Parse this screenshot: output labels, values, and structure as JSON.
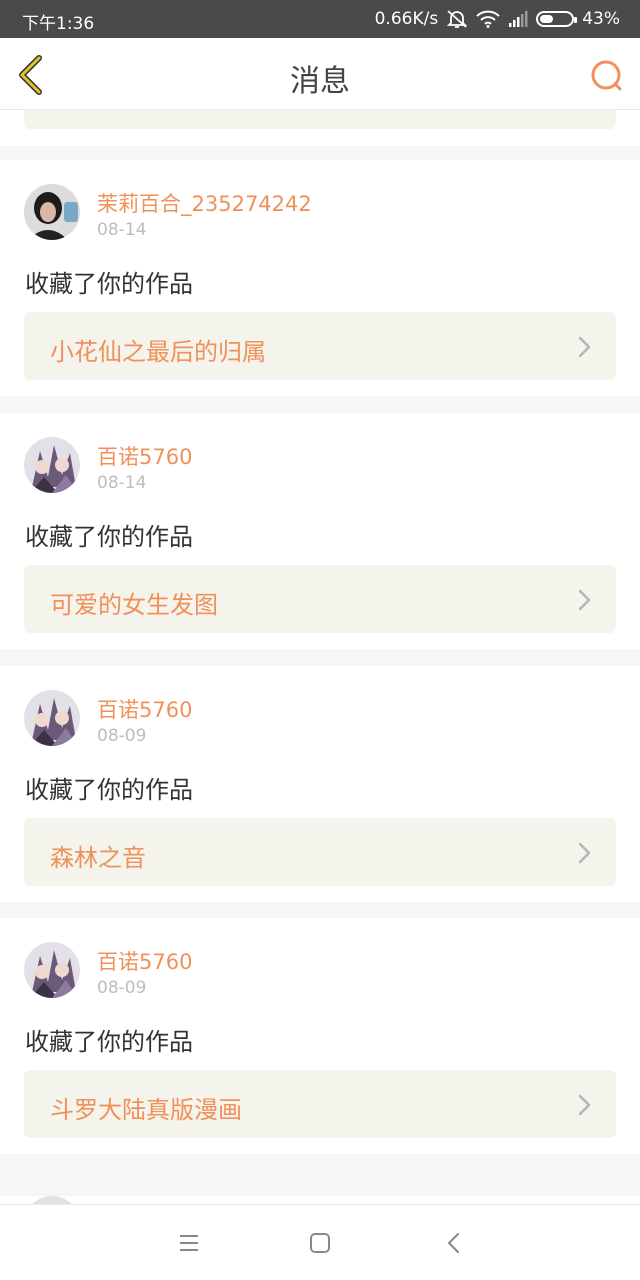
{
  "status_bar": {
    "time": "下午1:36",
    "speed": "0.66K/s",
    "battery": "43%",
    "battery_level": 0.43,
    "icons": [
      "mute-icon",
      "wifi-icon",
      "signal-icon",
      "battery-icon"
    ]
  },
  "header": {
    "title": "消息",
    "back_icon": "back-chevron-icon",
    "search_icon": "search-icon"
  },
  "colors": {
    "accent": "#f0915a",
    "back_icon": "#e6c22a",
    "card_bg": "#f4f3ec",
    "divider": "#f7f6f4",
    "status_bar": "#4a4a4a"
  },
  "messages": [
    {
      "username": "茉莉百合_235274242",
      "date": "08-14",
      "action": "收藏了你的作品",
      "work": "小花仙之最后的归属",
      "avatar": "photo-avatar"
    },
    {
      "username": "百诺5760",
      "date": "08-14",
      "action": "收藏了你的作品",
      "work": "可爱的女生发图",
      "avatar": "anime-avatar"
    },
    {
      "username": "百诺5760",
      "date": "08-09",
      "action": "收藏了你的作品",
      "work": "森林之音",
      "avatar": "anime-avatar"
    },
    {
      "username": "百诺5760",
      "date": "08-09",
      "action": "收藏了你的作品",
      "work": "斗罗大陆真版漫画",
      "avatar": "anime-avatar"
    }
  ],
  "nav_bar": {
    "icons": [
      "menu-icon",
      "home-icon",
      "back-icon"
    ]
  }
}
